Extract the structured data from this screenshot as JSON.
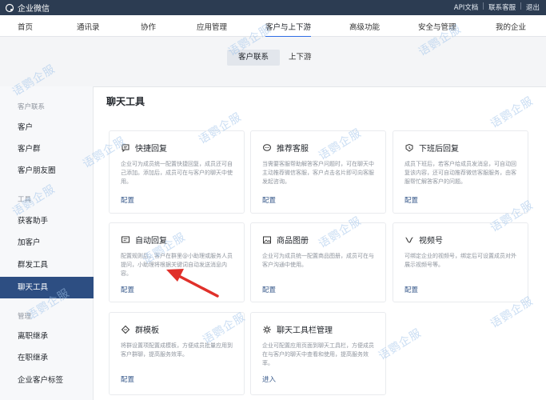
{
  "topbar": {
    "brand": "企业微信",
    "links": [
      "API文档",
      "联系客服",
      "退出"
    ]
  },
  "mainnav": {
    "items": [
      "首页",
      "通讯录",
      "协作",
      "应用管理",
      "客户与上下游",
      "高级功能",
      "安全与管理",
      "我的企业"
    ]
  },
  "subtabs": [
    "客户联系",
    "上下游"
  ],
  "sidebar": {
    "groups": [
      {
        "label": "客户联系",
        "items": [
          "客户",
          "客户群",
          "客户朋友圈"
        ]
      },
      {
        "label": "工具",
        "items": [
          "获客助手",
          "加客户",
          "群发工具",
          "聊天工具"
        ]
      },
      {
        "label": "管理",
        "items": [
          "离职继承",
          "在职继承",
          "企业客户标签"
        ]
      }
    ]
  },
  "main": {
    "title": "聊天工具",
    "cards": [
      {
        "title": "快捷回复",
        "icon": "chat-bubble-icon",
        "desc": "企业可为成员统一配置快捷回复，成员还可自己添加。添加后，成员可在与客户的聊天中使用。",
        "link": "配置"
      },
      {
        "title": "推荐客服",
        "icon": "chat-dots-icon",
        "desc": "当需要客服帮助解答客户问题时，可在聊天中主动推荐微信客服，客户点击名片即可向客服发起咨询。",
        "link": "配置"
      },
      {
        "title": "下班后回复",
        "icon": "clock-icon",
        "desc": "成员下班后，若客户给成员发消息，可自动回复该内容，还可自动推荐微信客服服务，由客服帮忙解答客户的问题。",
        "link": "配置"
      },
      {
        "title": "自动回复",
        "icon": "auto-reply-icon",
        "desc": "配置规则后，客户在群里@小助理或服务人员提问，小助理将根据关键词自动发送消息内容。",
        "link": "配置"
      },
      {
        "title": "商品图册",
        "icon": "album-icon",
        "desc": "企业可为成员统一配置商品图册，成员可在与客户沟通中使用。",
        "link": "配置"
      },
      {
        "title": "视频号",
        "icon": "channels-icon",
        "desc": "可绑定企业的视频号，绑定后可设置成员对外展示视频号等。",
        "link": "配置"
      },
      {
        "title": "群模板",
        "icon": "group-template-icon",
        "desc": "将群设置项配置成模板，方便成员批量应用到客户群聊，提高服务效率。",
        "link": "配置"
      },
      {
        "title": "聊天工具栏管理",
        "icon": "toolbar-icon",
        "desc": "企业可配置应用页面到聊天工具栏，方便成员在与客户的聊天中查看和使用，提高服务效率。",
        "link": "进入"
      }
    ]
  },
  "watermark": "语鹦企服",
  "colors": {
    "topbar": "#2c3c52",
    "sidebar_active": "#2d4e82",
    "nav_accent": "#2f6ee6",
    "arrow": "#e0302a",
    "watermark": "#9fc3ea"
  }
}
